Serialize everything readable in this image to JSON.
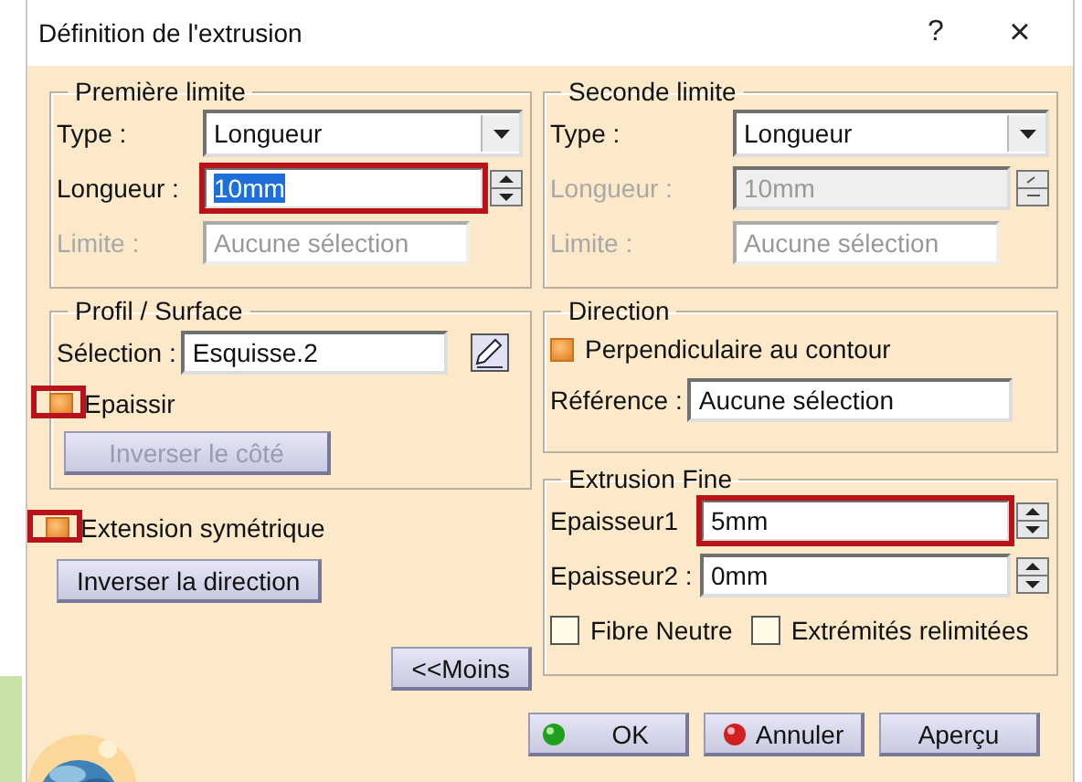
{
  "window": {
    "title": "Définition de l'extrusion",
    "help": "?",
    "close": "×"
  },
  "first_limit": {
    "title": "Première limite",
    "rows": [
      {
        "kind": "dropdown",
        "label": "Type :",
        "value": "Longueur",
        "disabled": false,
        "highlighted": false,
        "text_selected": false
      },
      {
        "kind": "spin",
        "label": "Longueur :",
        "value": "10mm",
        "disabled": false,
        "highlighted": true,
        "text_selected": true
      },
      {
        "kind": "text",
        "label": "Limite :",
        "value": "Aucune sélection",
        "disabled": true,
        "highlighted": false,
        "text_selected": false
      }
    ]
  },
  "profile": {
    "title": "Profil / Surface",
    "selection_label": "Sélection :",
    "selection_value": "Esquisse.2",
    "thicken": {
      "label": "Epaissir",
      "checked": true,
      "highlighted": true
    },
    "invert_side": {
      "label": "Inverser le côté",
      "disabled": true
    }
  },
  "symmetric": {
    "label": "Extension symétrique",
    "checked": true,
    "highlighted": true
  },
  "invert_direction": {
    "label": "Inverser la direction",
    "disabled": false
  },
  "less_button": "<<Moins",
  "second_limit": {
    "title": "Seconde limite",
    "rows": [
      {
        "kind": "dropdown",
        "label": "Type :",
        "value": "Longueur",
        "disabled": false,
        "highlighted": false,
        "text_selected": false
      },
      {
        "kind": "spin",
        "label": "Longueur :",
        "value": "10mm",
        "disabled": true,
        "highlighted": false,
        "text_selected": false
      },
      {
        "kind": "text",
        "label": "Limite :",
        "value": "Aucune sélection",
        "disabled": true,
        "highlighted": false,
        "text_selected": false
      }
    ]
  },
  "direction": {
    "title": "Direction",
    "perpendicular": {
      "label": "Perpendiculaire au contour",
      "checked": true
    },
    "reference_label": "Référence :",
    "reference_value": "Aucune sélection"
  },
  "thin": {
    "title": "Extrusion Fine",
    "rows": [
      {
        "kind": "spin",
        "label": "Epaisseur1",
        "value": "5mm",
        "disabled": false,
        "highlighted": true,
        "text_selected": false
      },
      {
        "kind": "spin",
        "label": "Epaisseur2 :",
        "value": "0mm",
        "disabled": false,
        "highlighted": false,
        "text_selected": false
      }
    ],
    "options": [
      {
        "label": "Fibre Neutre",
        "checked": false
      },
      {
        "label": "Extrémités relimitées",
        "checked": false
      }
    ]
  },
  "buttons": [
    {
      "kind": "ok",
      "label": "OK"
    },
    {
      "kind": "cancel",
      "label": "Annuler"
    },
    {
      "kind": "preview",
      "label": "Aperçu"
    }
  ]
}
